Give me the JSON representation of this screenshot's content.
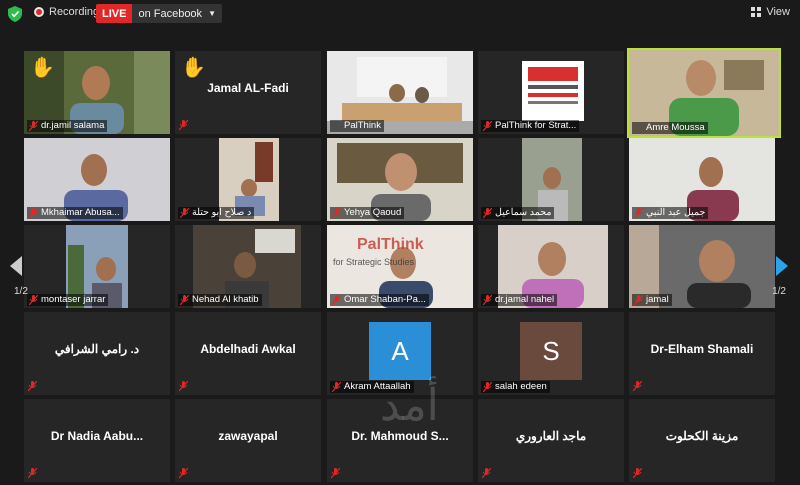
{
  "topbar": {
    "recording_label": "Recording",
    "live_badge": "LIVE",
    "live_target": "on Facebook",
    "view_label": "View"
  },
  "pager": {
    "left": "1/2",
    "right": "1/2"
  },
  "watermark": "أمد",
  "tiles": [
    {
      "name": "dr.jamil salama"
    },
    {
      "name": "Jamal AL-Fadi"
    },
    {
      "name": "PalThink"
    },
    {
      "name": "PalThink for Strat..."
    },
    {
      "name": "Amre Moussa"
    },
    {
      "name": "Mkhaimar Abusa..."
    },
    {
      "name": "د صلاح ابو حتلة"
    },
    {
      "name": "Yehya Qaoud"
    },
    {
      "name": "محمد سماعيل"
    },
    {
      "name": "جميل عبد النبي"
    },
    {
      "name": "montaser jarrar"
    },
    {
      "name": "Nehad Al khatib"
    },
    {
      "name": "Omar Shaban-Pa..."
    },
    {
      "name": "dr.jamal nahel"
    },
    {
      "name": "jamal"
    },
    {
      "name": "د. رامي الشرافي"
    },
    {
      "name": "Abdelhadi Awkal"
    },
    {
      "name": "Akram Attaallah",
      "initial": "A"
    },
    {
      "name": "salah edeen",
      "initial": "S"
    },
    {
      "name": "Dr-Elham Shamali"
    },
    {
      "name": "Dr Nadia Aabu..."
    },
    {
      "name": "zawayapal"
    },
    {
      "name": "Dr. Mahmoud S..."
    },
    {
      "name": "ماجد العاروري"
    },
    {
      "name": "مزينة الكحلوت"
    }
  ],
  "logo_text": {
    "brand": "PalThink",
    "sub": "for Strategic Studies"
  },
  "colors": {
    "live": "#e02828",
    "active_speaker": "#b9e23a",
    "avatar_a": "#2a8fd6",
    "avatar_s": "#6b4a3e",
    "muted_mic": "#e02828"
  }
}
